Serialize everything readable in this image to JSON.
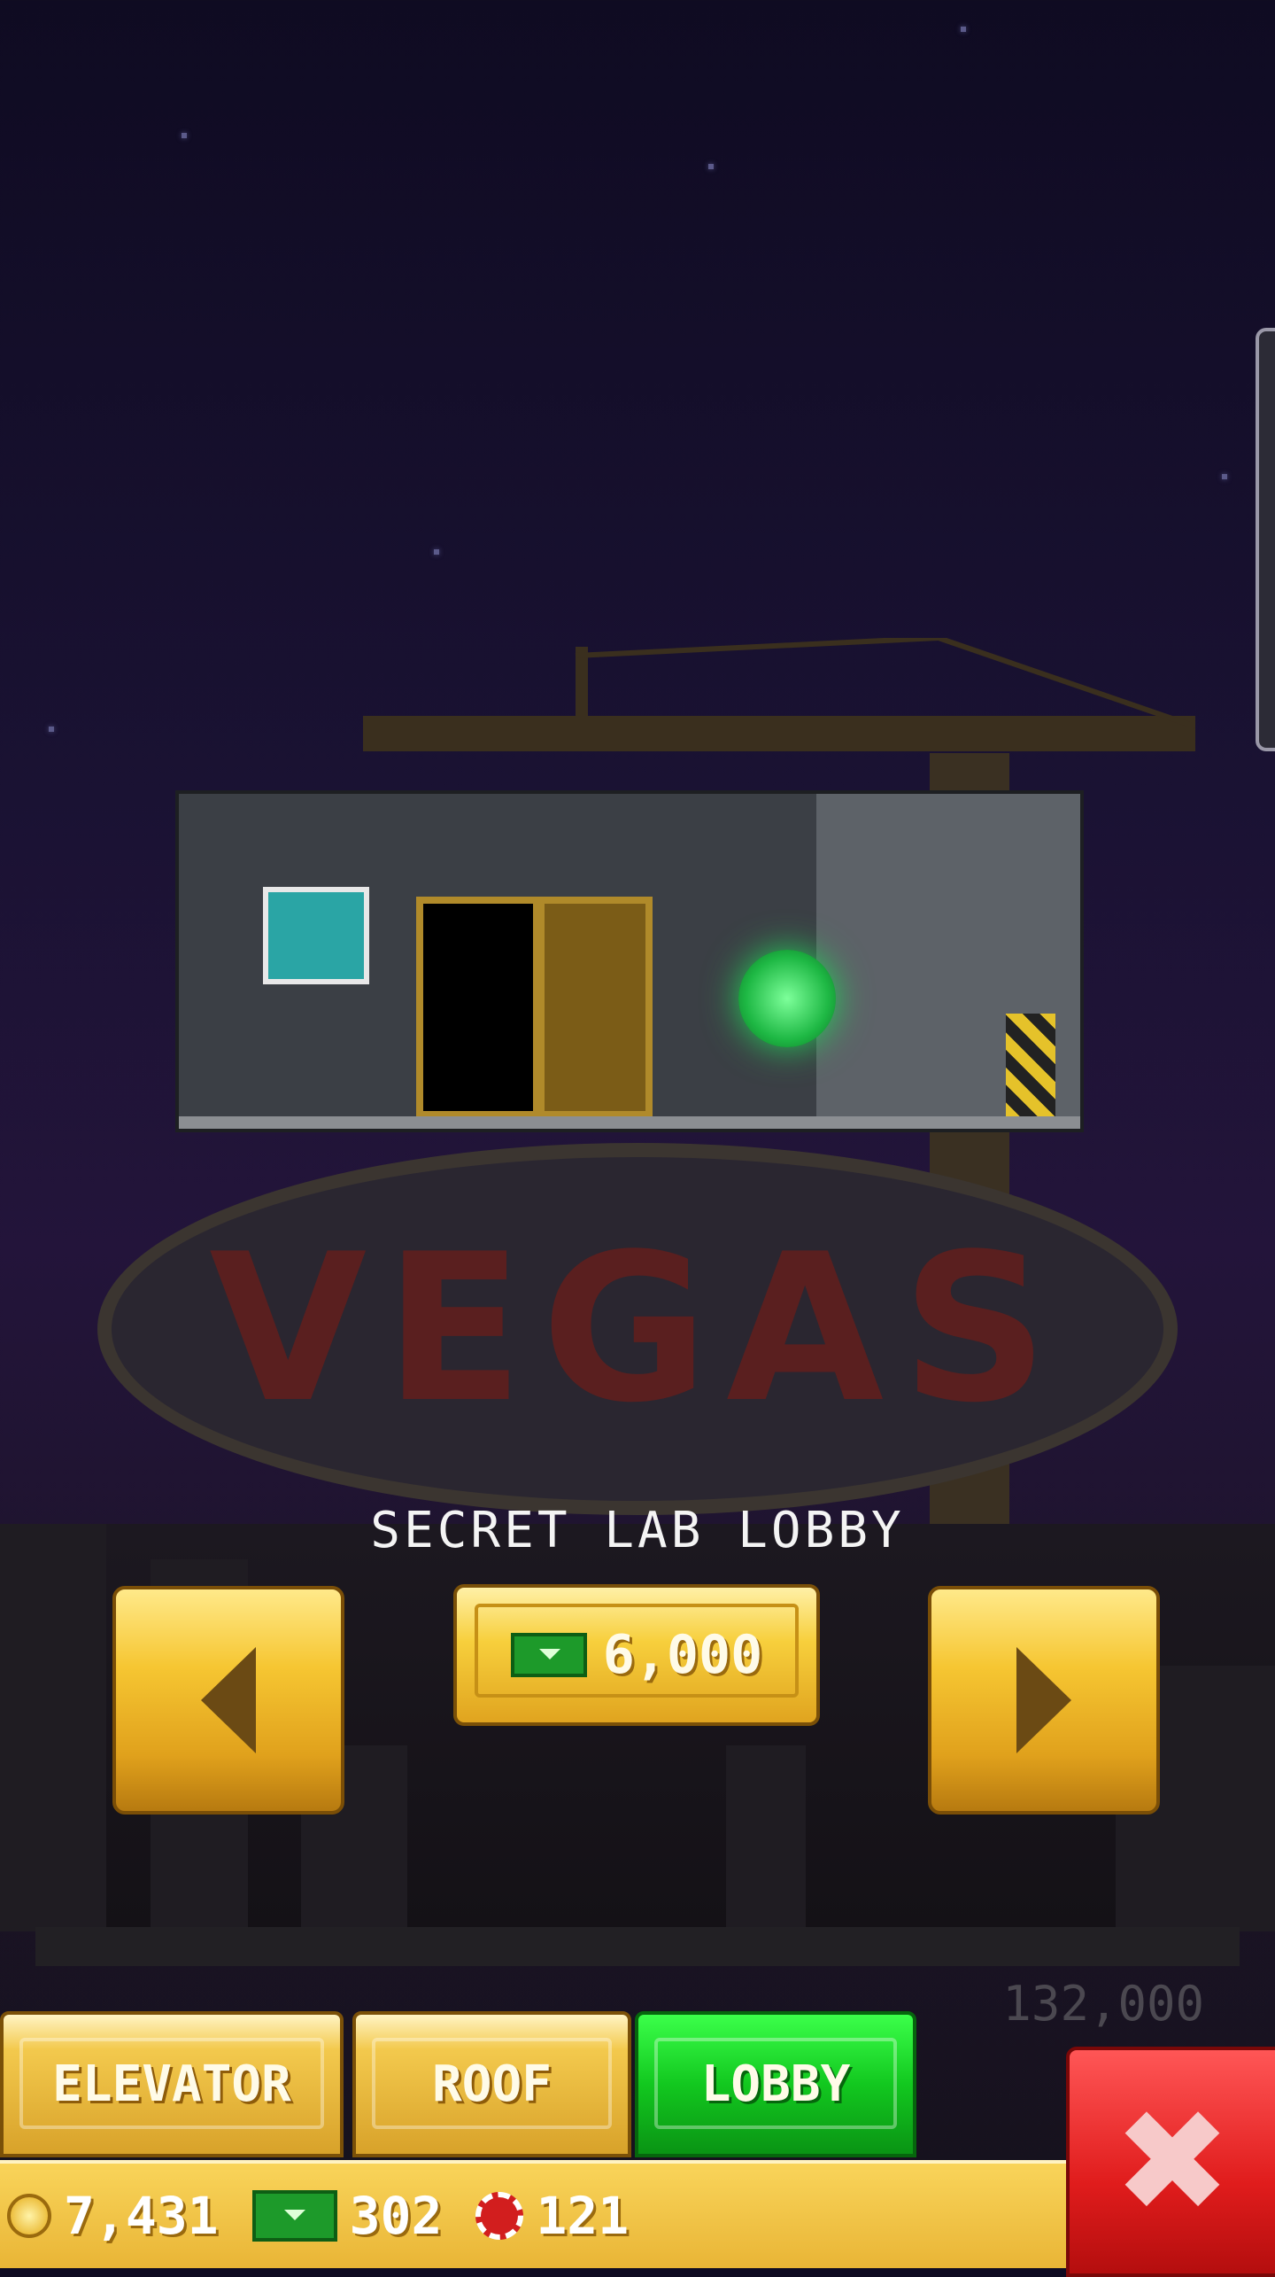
{
  "screen": {
    "room_label": "SECRET LAB LOBBY",
    "sign_text": "VEGAS",
    "floor_cost": "132,000"
  },
  "purchase": {
    "price": "6,000",
    "currency_icon": "bux-icon"
  },
  "navigation": {
    "prev_icon": "left-arrow-icon",
    "next_icon": "right-arrow-icon"
  },
  "tabs": [
    {
      "label": "ELEVATOR",
      "selected": false
    },
    {
      "label": "ROOF",
      "selected": false
    },
    {
      "label": "LOBBY",
      "selected": true
    }
  ],
  "status": {
    "coins": "7,431",
    "bux": "302",
    "chips": "121"
  },
  "colors": {
    "active_tab": "#12c81f",
    "button_gold": "#f6c632",
    "close_red": "#e01c1c"
  }
}
